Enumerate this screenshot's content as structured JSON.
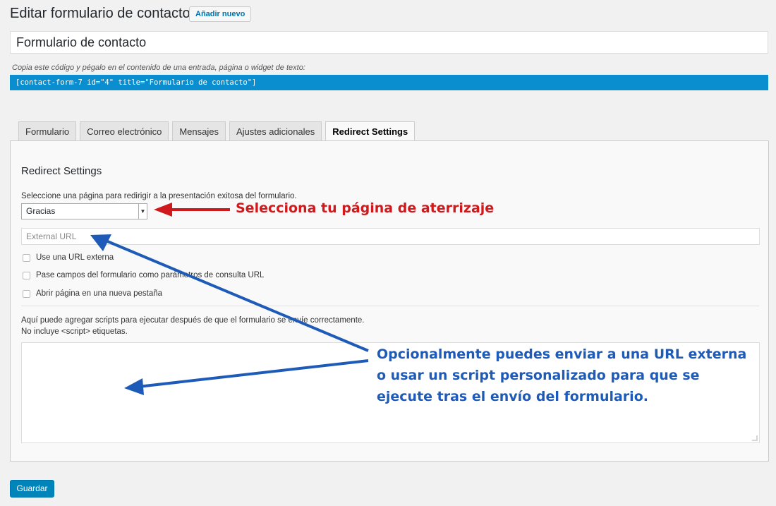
{
  "header": {
    "title": "Editar formulario de contacto",
    "add_new_label": "Añadir nuevo"
  },
  "form": {
    "title_value": "Formulario de contacto",
    "shortcode_hint": "Copia este código y pégalo en el contenido de una entrada, página o widget de texto:",
    "shortcode": "[contact-form-7 id=\"4\" title=\"Formulario de contacto\"]"
  },
  "tabs": [
    {
      "label": "Formulario"
    },
    {
      "label": "Correo electrónico"
    },
    {
      "label": "Mensajes"
    },
    {
      "label": "Ajustes adicionales"
    },
    {
      "label": "Redirect Settings",
      "active": true
    }
  ],
  "redirect": {
    "heading": "Redirect Settings",
    "select_label": "Seleccione una página para redirigir a la presentación exitosa del formulario.",
    "selected_page": "Gracias",
    "external_url_placeholder": "External URL",
    "options": [
      {
        "label": "Use una URL externa",
        "checked": false
      },
      {
        "label": "Pase campos del formulario como parámetros de consulta URL",
        "checked": false
      },
      {
        "label": "Abrir página en una nueva pestaña",
        "checked": false
      }
    ],
    "script_help_line1": "Aquí puede agregar scripts para ejecutar después de que el formulario se envíe correctamente.",
    "script_help_line2": "No incluye <script> etiquetas.",
    "script_value": ""
  },
  "save_label": "Guardar",
  "annotations": {
    "red_text": "Selecciona tu página de aterrizaje",
    "blue_line1": "Opcionalmente puedes enviar a una URL externa",
    "blue_line2": "o usar un script personalizado para que se",
    "blue_line3": "ejecute tras el envío del formulario.",
    "red_color": "#d0191c",
    "blue_color": "#1e5bb8"
  }
}
